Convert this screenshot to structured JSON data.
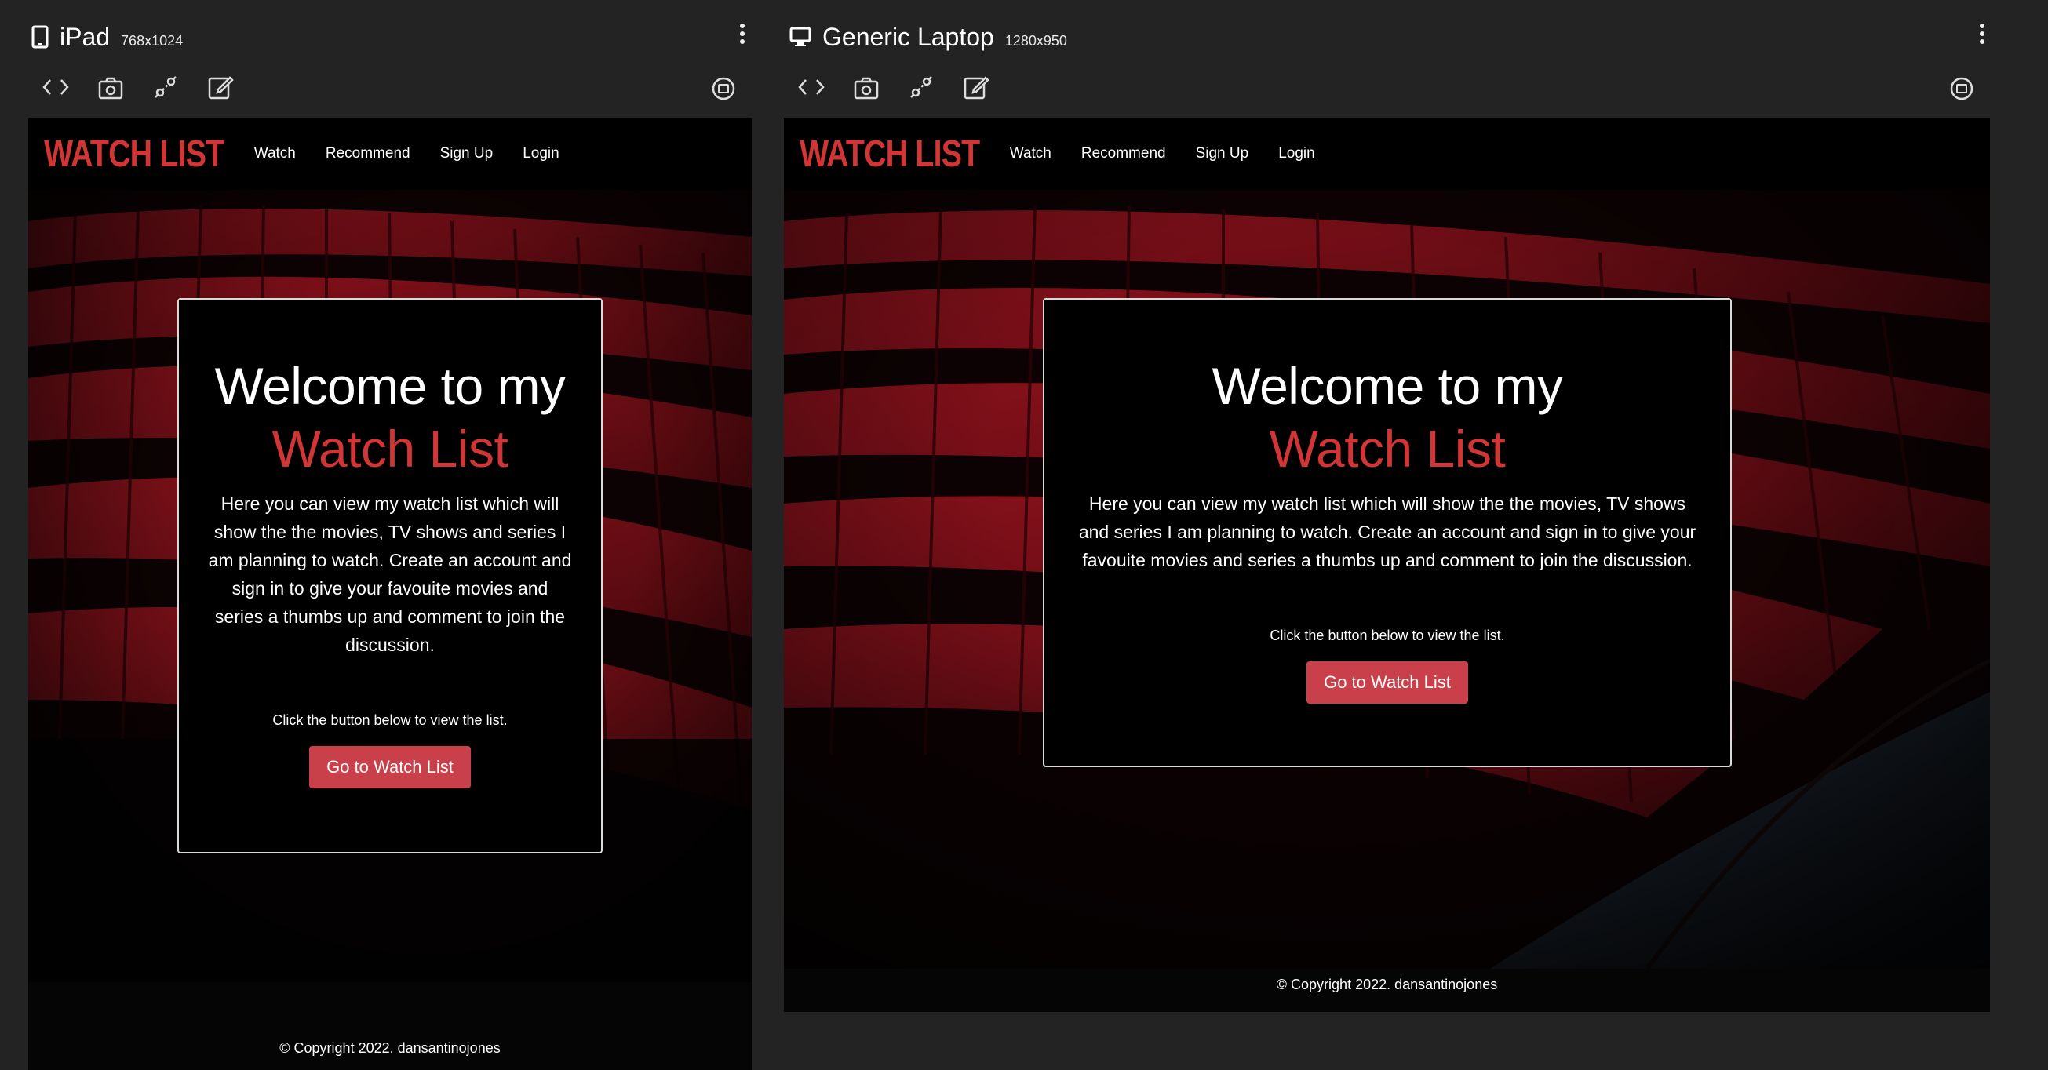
{
  "ipad": {
    "device_name": "iPad",
    "device_size": "768x1024"
  },
  "laptop": {
    "device_name": "Generic Laptop",
    "device_size": "1280x950"
  },
  "toolbar_icons": [
    "code-icon",
    "screenshot-icon",
    "inspect-icon",
    "edit-icon"
  ],
  "site": {
    "brand": "WATCH LIST",
    "nav": [
      "Watch",
      "Recommend",
      "Sign Up",
      "Login"
    ],
    "welcome_line1": "Welcome to my",
    "welcome_line2": "Watch List",
    "intro": "Here you can view my watch list which will show the the movies, TV shows and series I am planning to watch. Create an account and sign in to give your favouite movies and series a thumbs up and comment to join the discussion.",
    "hint": "Click the button below to view the list.",
    "cta": "Go to Watch List",
    "footer": "© Copyright 2022. dansantinojones"
  },
  "colors": {
    "accent": "#d23535",
    "button": "#c9404a",
    "frame_bg": "#232323"
  }
}
